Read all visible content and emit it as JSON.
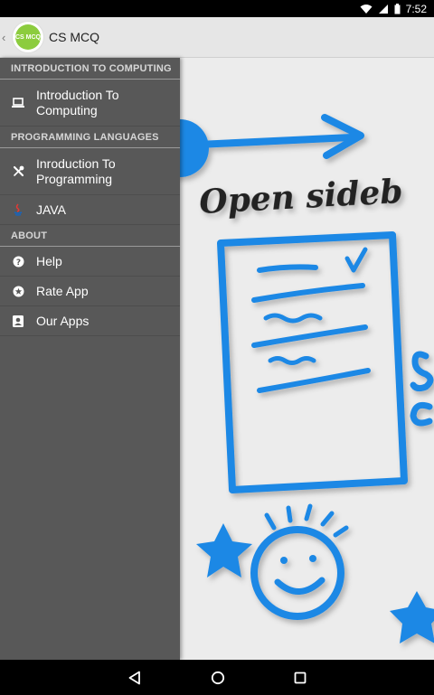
{
  "status_bar": {
    "time": "7:52"
  },
  "app": {
    "title": "CS MCQ",
    "logo_text": "CS MCQ"
  },
  "drawer": {
    "sections": [
      {
        "header": "INTRODUCTION TO COMPUTING",
        "items": [
          {
            "label": "Introduction To Computing",
            "icon": "laptop-icon"
          }
        ]
      },
      {
        "header": "PROGRAMMING LANGUAGES",
        "items": [
          {
            "label": "Inroduction To Programming",
            "icon": "tools-icon"
          },
          {
            "label": "JAVA",
            "icon": "java-icon"
          }
        ]
      },
      {
        "header": "ABOUT",
        "items": [
          {
            "label": "Help",
            "icon": "help-icon"
          },
          {
            "label": "Rate App",
            "icon": "star-icon"
          },
          {
            "label": "Our Apps",
            "icon": "contact-icon"
          }
        ]
      }
    ]
  },
  "illustration": {
    "text_line1": "Open sideb",
    "text_fragment": "S a"
  },
  "nav": {
    "icons": [
      "back-icon",
      "home-icon",
      "recents-icon"
    ]
  },
  "colors": {
    "drawer_bg": "#585858",
    "sketch_blue": "#1e88e5",
    "action_bar": "#e6e6e6"
  }
}
